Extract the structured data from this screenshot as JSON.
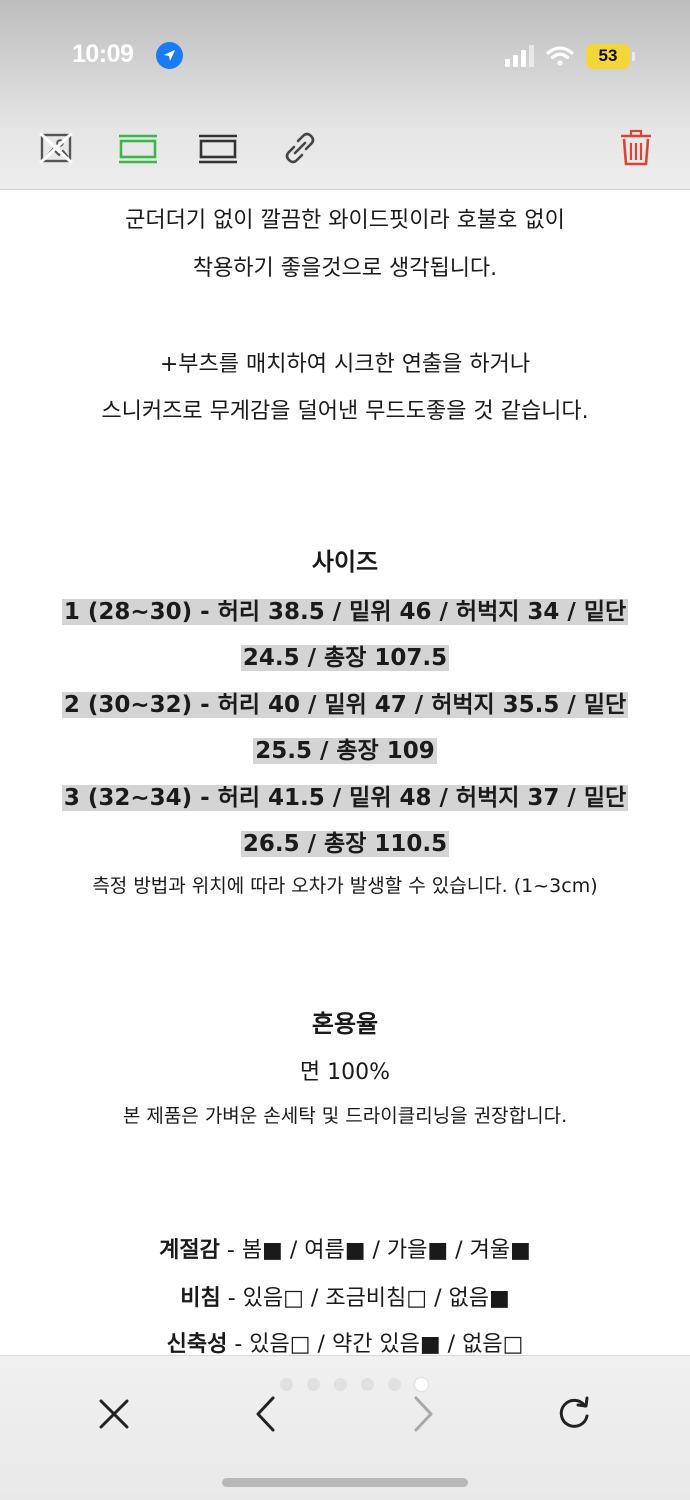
{
  "status_bar": {
    "time": "10:09",
    "battery": "53"
  },
  "content": {
    "intro_lines": [
      "군더더기 없이 깔끔한 와이드핏이라 호불호 없이",
      "착용하기 좋을것으로 생각됩니다.",
      "+부츠를 매치하여 시크한 연출을 하거나",
      "스니커즈로 무게감을 덜어낸 무드도좋을 것 같습니다."
    ],
    "size_title": "사이즈",
    "size_lines": [
      "1 (28~30) - 허리 38.5 / 밑위 46 / 허벅지 34 / 밑단",
      "24.5 / 총장 107.5",
      "2 (30~32) - 허리 40 / 밑위 47 / 허벅지 35.5 / 밑단",
      "25.5 / 총장 109",
      "3 (32~34) - 허리 41.5 / 밑위 48 / 허벅지 37 / 밑단",
      "26.5 / 총장 110.5"
    ],
    "size_note": "측정 방법과 위치에 따라 오차가 발생할 수 있습니다. (1~3cm)",
    "fabric_title": "혼용율",
    "fabric_value": "면 100%",
    "fabric_note": "본 제품은 가벼운 손세탁 및 드라이클리닝을 권장합니다.",
    "attributes": [
      {
        "label": "계절감",
        "value": " - 봄■ / 여름■ / 가을■ / 겨울■"
      },
      {
        "label": "비침",
        "value": " - 있음□ / 조금비침□ / 없음■"
      },
      {
        "label": "신축성",
        "value": " - 있음□ / 약간 있음■ / 없음□"
      }
    ]
  },
  "colors": {
    "accent_green": "#3cb54a",
    "trash_red": "#d9443a",
    "location_blue": "#1a7cf5",
    "battery_yellow": "#f2d63a",
    "highlight_gray": "#d4d4d4"
  },
  "icons": {
    "toolbar": [
      "no-image-icon",
      "filled-frame-icon",
      "frame-icon",
      "link-icon",
      "trash-icon"
    ],
    "nav": [
      "close-icon",
      "back-icon",
      "forward-icon",
      "reload-icon"
    ]
  }
}
